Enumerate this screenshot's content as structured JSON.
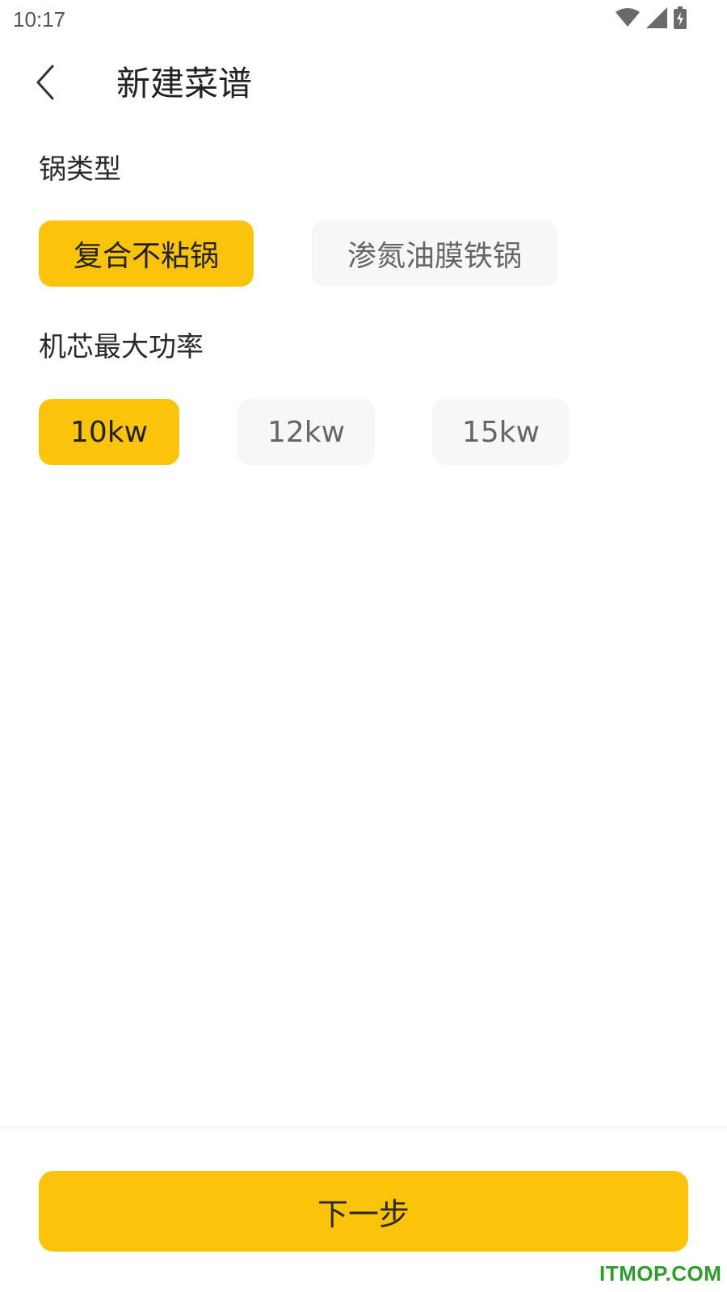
{
  "status_bar": {
    "time": "10:17",
    "icons": [
      "wifi-icon",
      "cellular-signal-icon",
      "battery-charging-icon"
    ]
  },
  "header": {
    "back_icon": "chevron-left-icon",
    "title": "新建菜谱"
  },
  "pot_type": {
    "label": "锅类型",
    "options": [
      {
        "label": "复合不粘锅",
        "selected": true
      },
      {
        "label": "渗氮油膜铁锅",
        "selected": false
      }
    ]
  },
  "power": {
    "label": "机芯最大功率",
    "options": [
      {
        "label": "10kw",
        "selected": true
      },
      {
        "label": "12kw",
        "selected": false
      },
      {
        "label": "15kw",
        "selected": false
      }
    ]
  },
  "footer": {
    "next_label": "下一步"
  },
  "watermark": "ITMOP.COM",
  "colors": {
    "accent": "#fbc30a",
    "unselected_bg": "#f7f7f7",
    "watermark": "#2e9c29"
  }
}
